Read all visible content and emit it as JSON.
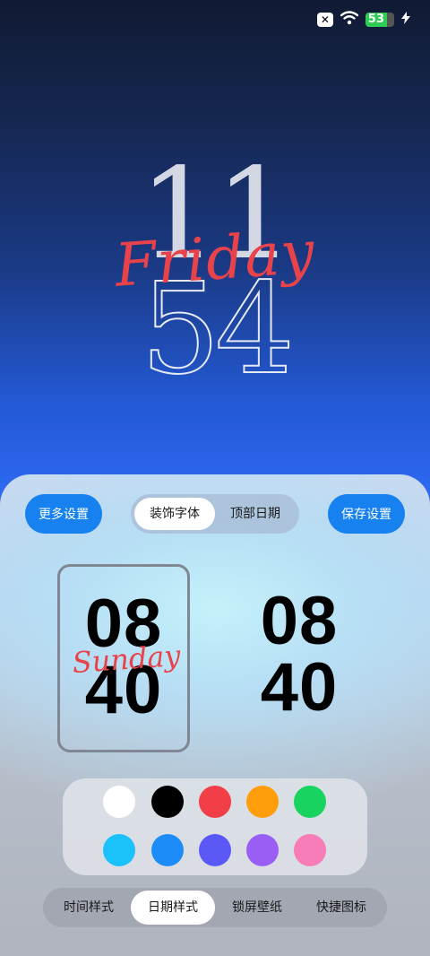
{
  "status_bar": {
    "sim_icon": "x-box-icon",
    "wifi_icon": "wifi-icon",
    "battery_level": "53",
    "charging_icon": "bolt-icon"
  },
  "lockscreen_clock": {
    "hour": "11",
    "minute": "54",
    "day": "Friday",
    "day_color": "#e8434a"
  },
  "panel": {
    "more_settings_label": "更多设置",
    "save_settings_label": "保存设置",
    "segment": {
      "options": [
        "装饰字体",
        "顶部日期"
      ],
      "selected": "装饰字体"
    },
    "previews": [
      {
        "hour": "08",
        "minute": "40",
        "day": "Sunday",
        "selected": true
      },
      {
        "hour": "08",
        "minute": "40",
        "day": "",
        "selected": false
      }
    ],
    "palette": {
      "colors": [
        "#ffffff",
        "#000000",
        "#f23e46",
        "#ff9d0a",
        "#19d360",
        "#1ac1fa",
        "#1e8cf8",
        "#5b59f5",
        "#9a5ef4",
        "#f77cb8"
      ]
    },
    "tabs": {
      "items": [
        "时间样式",
        "日期样式",
        "锁屏壁纸",
        "快捷图标"
      ],
      "selected": "日期样式"
    }
  }
}
